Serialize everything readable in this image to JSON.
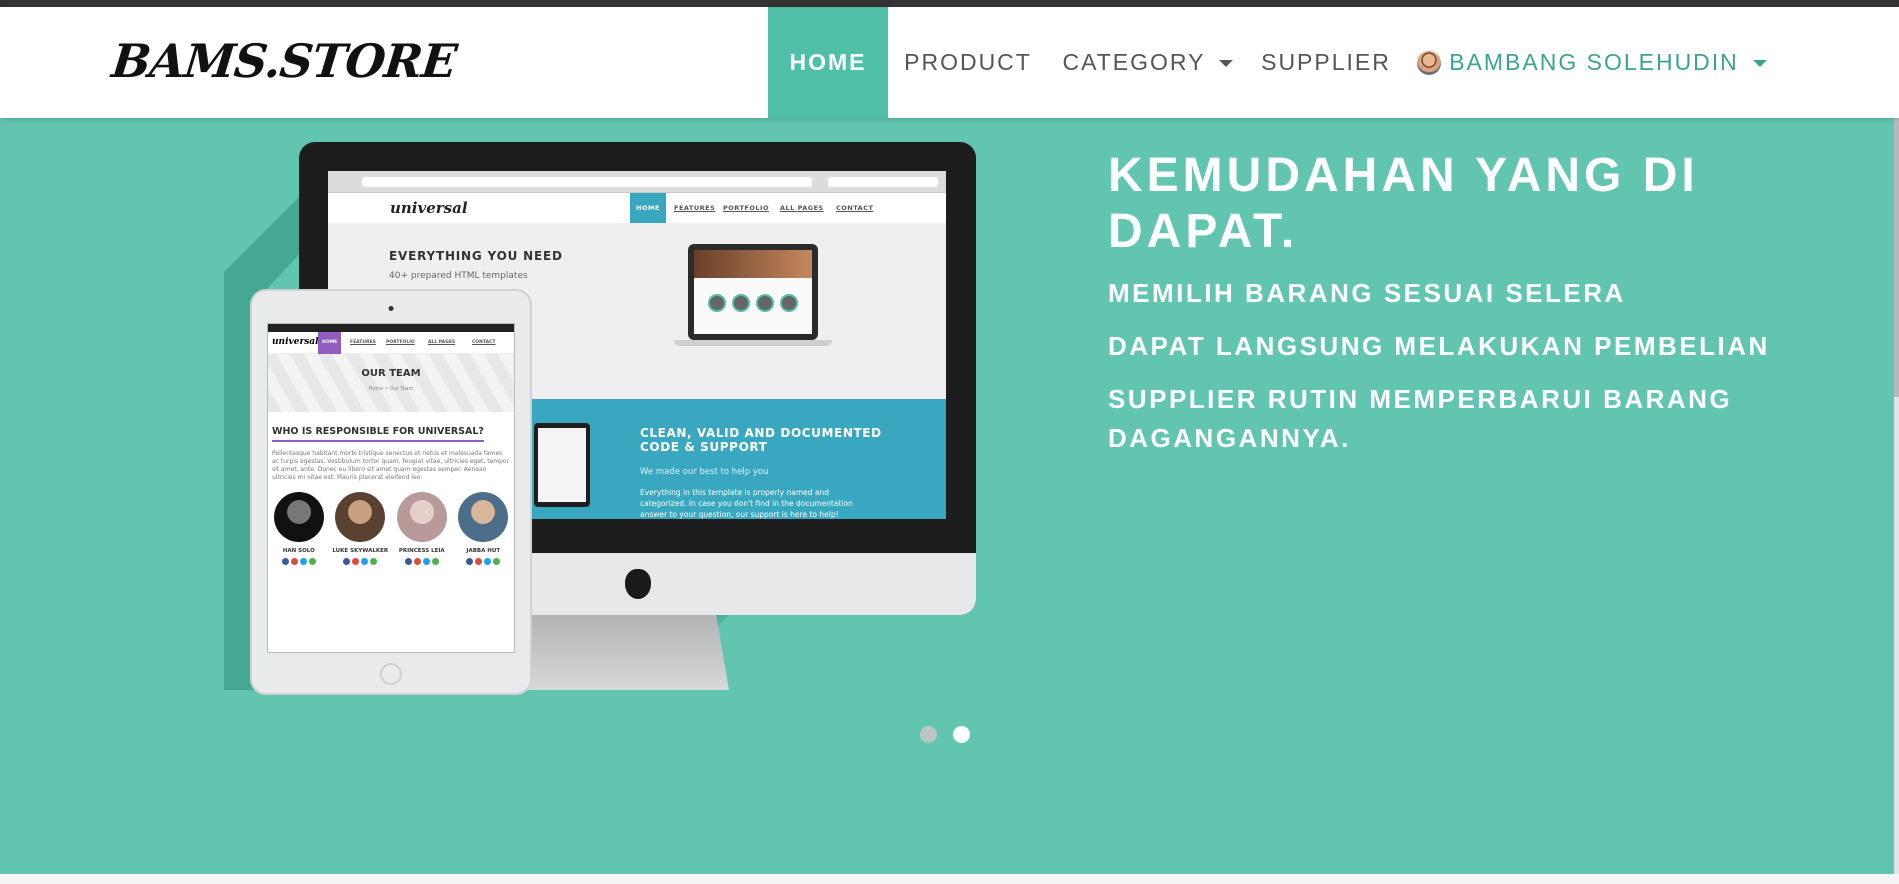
{
  "brand": {
    "logo_text": "BAMS.STORE"
  },
  "nav": {
    "items": [
      {
        "label": "HOME",
        "active": true
      },
      {
        "label": "PRODUCT"
      },
      {
        "label": "CATEGORY",
        "dropdown": true
      },
      {
        "label": "SUPPLIER"
      }
    ],
    "user": {
      "name": "BAMBANG SOLEHUDIN",
      "dropdown": true
    }
  },
  "hero": {
    "title": "KEMUDAHAN YANG DI DAPAT.",
    "points": [
      "MEMILIH BARANG SESUAI SELERA",
      "DAPAT LANGSUNG MELAKUKAN PEMBELIAN",
      "SUPPLIER RUTIN MEMPERBARUI BARANG DAGANGANNYA."
    ],
    "carousel": {
      "slides": 2,
      "active_index": 1
    }
  },
  "mockup": {
    "desktop": {
      "logo": "universal",
      "nav": [
        "HOME",
        "FEATURES",
        "PORTFOLIO",
        "ALL PAGES",
        "CONTACT"
      ],
      "heading": "EVERYTHING YOU NEED",
      "subheading": "40+ prepared HTML templates",
      "band_title": "CLEAN, VALID AND DOCUMENTED CODE & SUPPORT",
      "band_sub": "We made our best to help you",
      "band_body": "Everything in this template is properly named and categorized. In case you don't find in the documentation answer to your question, our support is here to help!"
    },
    "tablet": {
      "logo": "universal",
      "nav": [
        "HOME",
        "FEATURES",
        "PORTFOLIO",
        "ALL PAGES",
        "CONTACT"
      ],
      "banner_title": "OUR TEAM",
      "banner_sub": "Home  »  Our Team",
      "question": "WHO IS RESPONSIBLE FOR UNIVERSAL?",
      "paragraph": "Pellentesque habitant morbi tristique senectus et netus et malesuada fames ac turpis egestas. Vestibulum tortor quam, feugiat vitae, ultricies eget, tempor sit amet, ante. Donec eu libero sit amet quam egestas semper. Aenean ultricies mi vitae est. Mauris placerat eleifend leo.",
      "members": [
        "HAN SOLO",
        "LUKE SKYWALKER",
        "PRINCESS LEIA",
        "JABBA HUT"
      ]
    }
  },
  "colors": {
    "accent": "#61c5b0",
    "active_nav": "#4fbfa8",
    "user_text": "#3aa58e"
  }
}
